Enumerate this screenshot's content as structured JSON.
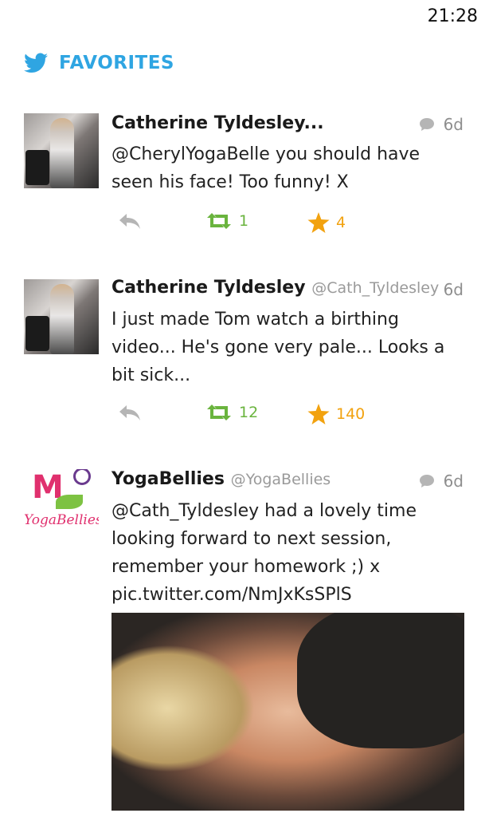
{
  "status": {
    "time": "21:28"
  },
  "header": {
    "title": "FAVORITES",
    "icon": "twitter-bird-icon",
    "accent": "#2fa5e2"
  },
  "tweets": [
    {
      "name": "Catherine Tyldesley...",
      "handle": "",
      "time": "6d",
      "text": "@CherylYogaBelle you should have seen his face! Too funny! X",
      "retweets": "1",
      "favorites": "4"
    },
    {
      "name": "Catherine Tyldesley",
      "handle": "@Cath_Tyldesley",
      "time": "6d",
      "text": "I just made Tom watch a birthing video... He's gone very pale... Looks a bit sick...",
      "retweets": "12",
      "favorites": "140"
    },
    {
      "name": "YogaBellies",
      "handle": "@YogaBellies",
      "time": "6d",
      "text": "@Cath_Tyldesley had a lovely time looking forward to next session, remember your homework ;) x pic.twitter.com/NmJxKsSPlS",
      "logo_text": "YogaBellies"
    }
  ],
  "colors": {
    "retweet": "#6ab43e",
    "favorite": "#f2a20f",
    "muted": "#8e8e8e"
  }
}
